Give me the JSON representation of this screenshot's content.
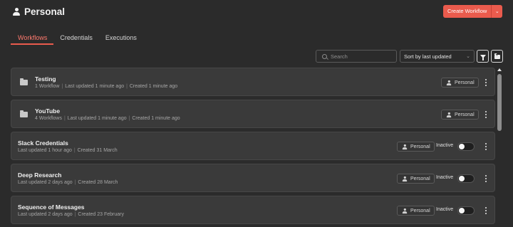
{
  "header": {
    "title": "Personal",
    "create_button": "Create Workflow"
  },
  "tabs": [
    {
      "label": "Workflows",
      "active": true
    },
    {
      "label": "Credentials",
      "active": false
    },
    {
      "label": "Executions",
      "active": false
    }
  ],
  "toolbar": {
    "search_placeholder": "Search",
    "sort_value": "Sort by last updated"
  },
  "items": [
    {
      "type": "folder",
      "title": "Testing",
      "meta": [
        "1 Workflow",
        "Last updated 1 minute ago",
        "Created 1 minute ago"
      ],
      "owner": "Personal"
    },
    {
      "type": "folder",
      "title": "YouTube",
      "meta": [
        "4 Workflows",
        "Last updated 1 minute ago",
        "Created 1 minute ago"
      ],
      "owner": "Personal"
    },
    {
      "type": "workflow",
      "title": "Slack Credentials",
      "meta": [
        "Last updated 1 hour ago",
        "Created 31 March"
      ],
      "owner": "Personal",
      "status": "Inactive",
      "active": false
    },
    {
      "type": "workflow",
      "title": "Deep Research",
      "meta": [
        "Last updated 2 days ago",
        "Created 28 March"
      ],
      "owner": "Personal",
      "status": "Inactive",
      "active": false
    },
    {
      "type": "workflow",
      "title": "Sequence of Messages",
      "meta": [
        "Last updated 2 days ago",
        "Created 23 February"
      ],
      "owner": "Personal",
      "status": "Inactive",
      "active": false
    }
  ],
  "colors": {
    "accent": "#ea5b4d",
    "background": "#2b2b2b",
    "card": "#3a3a3a"
  }
}
